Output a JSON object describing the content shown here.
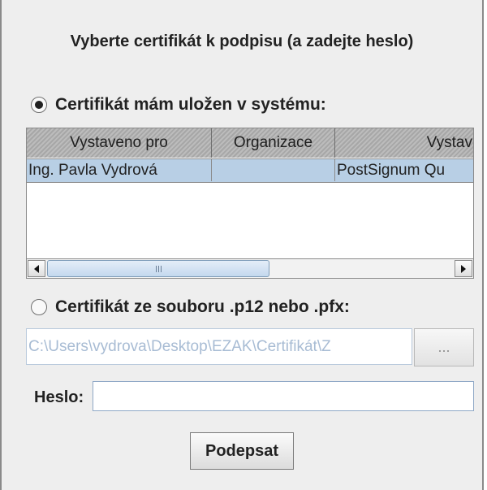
{
  "dialog": {
    "title": "Vyberte certifikát k podpisu (a zadejte heslo)"
  },
  "option_system": {
    "label": "Certifikát mám uložen v systému:",
    "selected": true
  },
  "cert_table": {
    "columns": [
      "Vystaveno pro",
      "Organizace",
      "Vystav"
    ],
    "rows": [
      [
        "Ing. Pavla Vydrová",
        "",
        "PostSignum Qu"
      ]
    ]
  },
  "option_file": {
    "label": "Certifikát ze souboru .p12 nebo .pfx:",
    "selected": false
  },
  "file_path": {
    "value": "C:\\Users\\vydrova\\Desktop\\EZAK\\Certifikát\\Z",
    "browse_label": "..."
  },
  "password": {
    "label": "Heslo:",
    "value": ""
  },
  "actions": {
    "sign_label": "Podepsat"
  },
  "colors": {
    "selection": "#b8cfe5",
    "panel": "#eeeeee",
    "disabled_text": "#a8bcd4"
  }
}
